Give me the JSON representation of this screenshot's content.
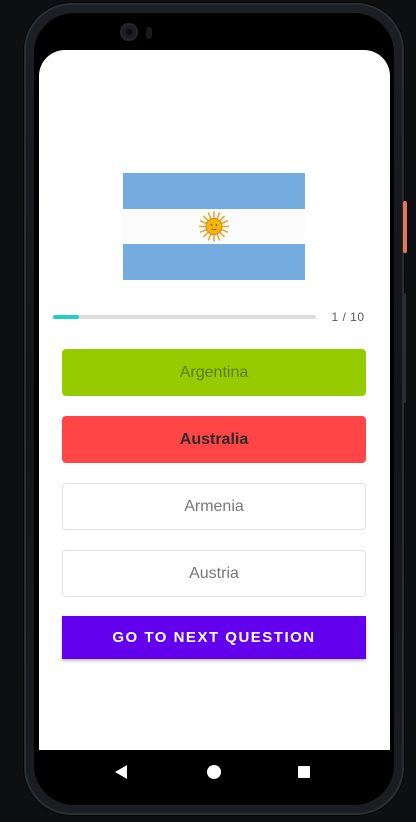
{
  "quiz": {
    "flag": {
      "country": "Argentina",
      "colors": {
        "stripe": "#74acdf",
        "middle": "#fbfbfb",
        "sun": "#e9a72f"
      }
    },
    "progress": {
      "current": 1,
      "total": 10,
      "label": "1 / 10",
      "fraction": 0.1,
      "color": "#1fd1c2"
    },
    "options": [
      {
        "label": "Argentina",
        "state": "correct",
        "color": "#96cb00"
      },
      {
        "label": "Australia",
        "state": "wrong",
        "color": "#ff4545"
      },
      {
        "label": "Armenia",
        "state": "neutral"
      },
      {
        "label": "Austria",
        "state": "neutral"
      }
    ],
    "next_button": {
      "label": "GO TO NEXT QUESTION",
      "color": "#6200ee"
    }
  },
  "navigation": {
    "icons": [
      "back-icon",
      "home-icon",
      "recents-icon"
    ]
  }
}
